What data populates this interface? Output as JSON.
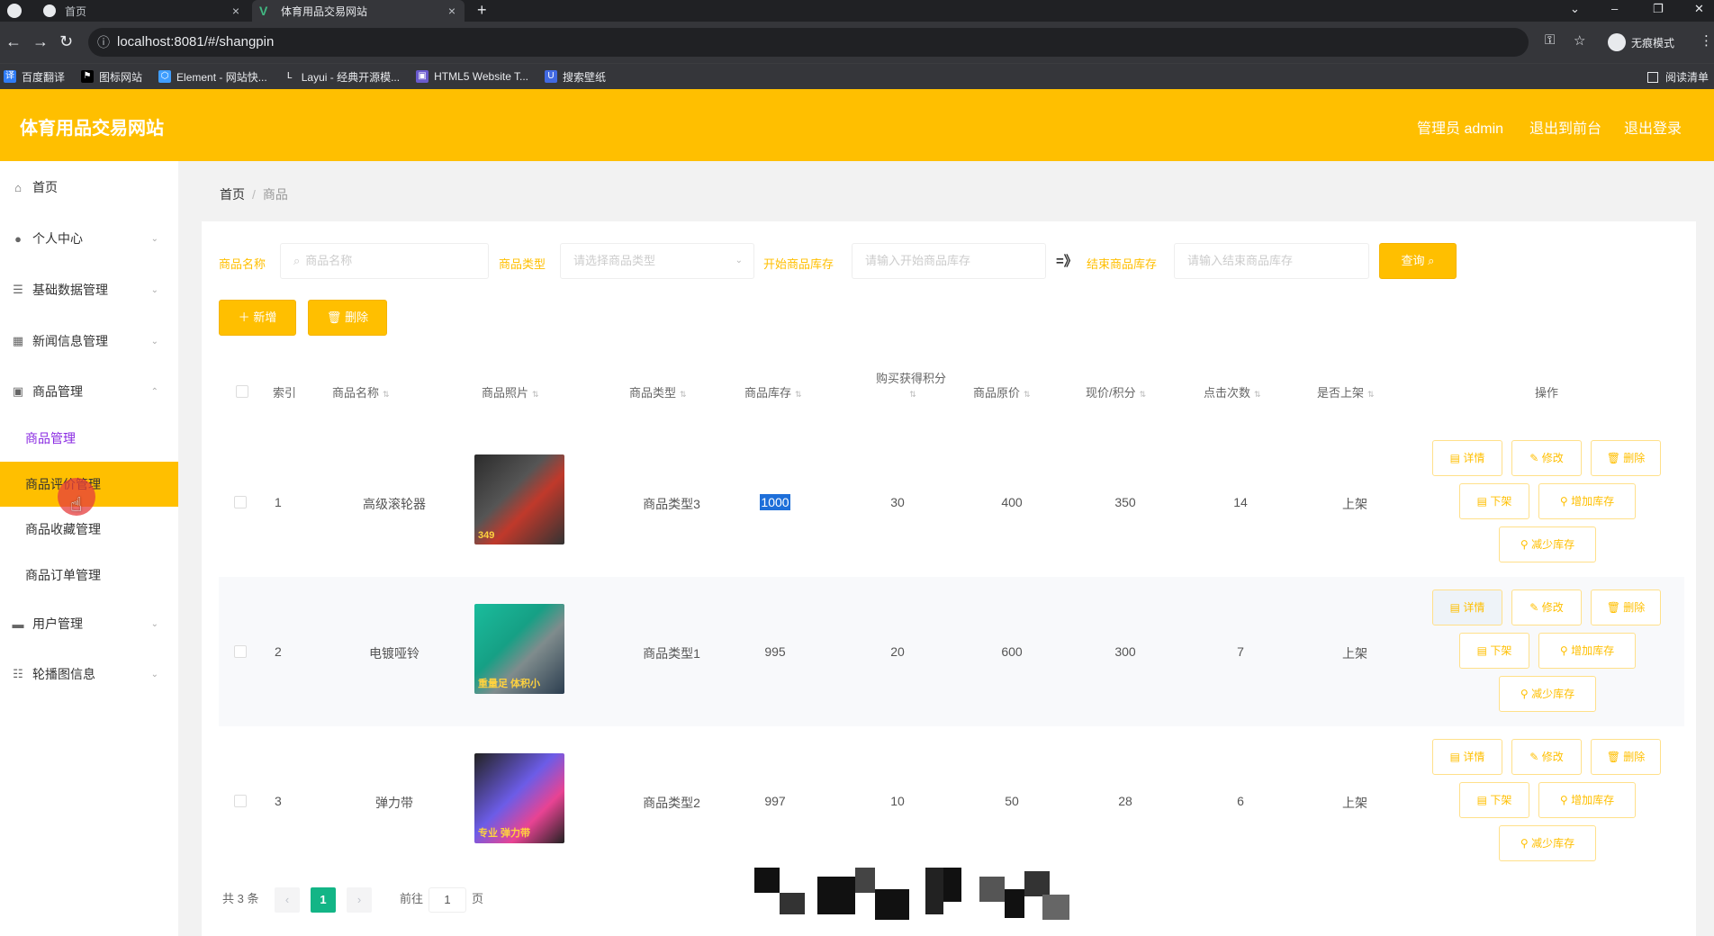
{
  "browser": {
    "tabs": [
      {
        "title": "首页",
        "close": "×"
      },
      {
        "title": "体育用品交易网站",
        "close": "×",
        "favicon": "V"
      }
    ],
    "new_tab": "+",
    "url": "localhost:8081/#/shangpin",
    "profile": "无痕模式",
    "bookmarks": [
      "百度翻译",
      "图标网站",
      "Element - 网站快...",
      "Layui - 经典开源模...",
      "HTML5 Website T...",
      "搜索壁纸"
    ],
    "reading_list": "阅读清单"
  },
  "header": {
    "logo": "体育用品交易网站",
    "admin": "管理员 admin",
    "back_to_front": "退出到前台",
    "logout": "退出登录",
    "color": "#ffbf00"
  },
  "sidebar": {
    "items": [
      {
        "label": "首页",
        "icon": "home-icon"
      },
      {
        "label": "个人中心",
        "icon": "user-icon"
      },
      {
        "label": "基础数据管理",
        "icon": "list-icon"
      },
      {
        "label": "新闻信息管理",
        "icon": "grid-icon"
      },
      {
        "label": "商品管理",
        "icon": "box-icon"
      },
      {
        "label": "用户管理",
        "icon": "monitor-icon"
      },
      {
        "label": "轮播图信息",
        "icon": "sliders-icon"
      }
    ],
    "sub_items": [
      "商品管理",
      "商品评价管理",
      "商品收藏管理",
      "商品订单管理"
    ]
  },
  "breadcrumb": {
    "home": "首页",
    "sep": "/",
    "current": "商品"
  },
  "search": {
    "name_label": "商品名称",
    "name_placeholder": "商品名称",
    "type_label": "商品类型",
    "type_placeholder": "请选择商品类型",
    "stock_start_label": "开始商品库存",
    "stock_start_placeholder": "请输入开始商品库存",
    "range_sep": "=》",
    "stock_end_label": "结束商品库存",
    "stock_end_placeholder": "请输入结束商品库存",
    "query_button": "查询"
  },
  "toolbar": {
    "add": "新增",
    "delete": "删除"
  },
  "table": {
    "headers": [
      "索引",
      "商品名称",
      "商品照片",
      "商品类型",
      "商品库存",
      "购买获得积分",
      "商品原价",
      "现价/积分",
      "点击次数",
      "是否上架",
      "操作"
    ],
    "rows": [
      {
        "index": "1",
        "name": "高级滚轮器",
        "photo_label": "349",
        "type": "商品类型3",
        "stock": "1000",
        "points": "30",
        "orig_price": "400",
        "price": "350",
        "clicks": "14",
        "status": "上架"
      },
      {
        "index": "2",
        "name": "电镀哑铃",
        "photo_label": "重量足 体积小",
        "type": "商品类型1",
        "stock": "995",
        "points": "20",
        "orig_price": "600",
        "price": "300",
        "clicks": "7",
        "status": "上架"
      },
      {
        "index": "3",
        "name": "弹力带",
        "photo_label": "专业 弹力带",
        "type": "商品类型2",
        "stock": "997",
        "points": "10",
        "orig_price": "50",
        "price": "28",
        "clicks": "6",
        "status": "上架"
      }
    ],
    "actions": {
      "detail": "详情",
      "edit": "修改",
      "delete": "删除",
      "offshelf": "下架",
      "add_stock": "增加库存",
      "reduce_stock": "减少库存"
    }
  },
  "pagination": {
    "total": "共 3 条",
    "prev": "‹",
    "current": "1",
    "next": "›",
    "goto": "前往",
    "page_input": "1",
    "page_unit": "页"
  }
}
